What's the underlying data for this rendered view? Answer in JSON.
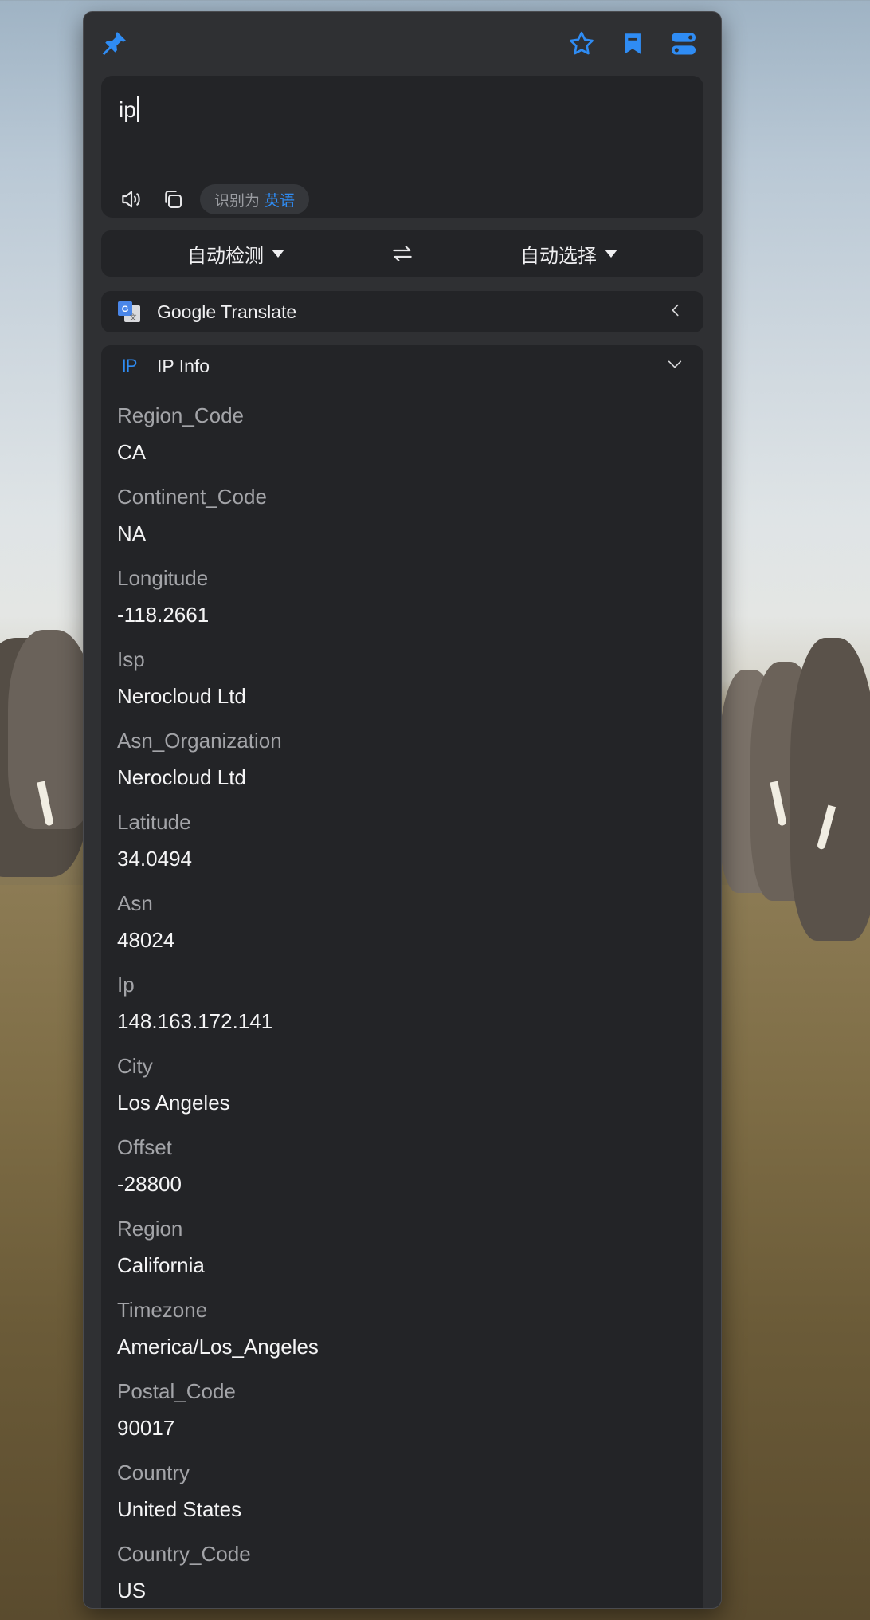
{
  "input": {
    "text": "ip"
  },
  "detect": {
    "prefix": "识别为",
    "language": "英语"
  },
  "language_bar": {
    "source": "自动检测",
    "target": "自动选择"
  },
  "services": [
    {
      "name": "Google Translate",
      "icon": "google-translate-icon",
      "expanded": false
    },
    {
      "name": "IP Info",
      "icon": "ip-icon",
      "icon_text": "IP",
      "expanded": true
    }
  ],
  "ip_info": {
    "fields": [
      {
        "key": "Region_Code",
        "value": "CA"
      },
      {
        "key": "Continent_Code",
        "value": "NA"
      },
      {
        "key": "Longitude",
        "value": "-118.2661"
      },
      {
        "key": "Isp",
        "value": "Nerocloud Ltd"
      },
      {
        "key": "Asn_Organization",
        "value": "Nerocloud Ltd"
      },
      {
        "key": "Latitude",
        "value": "34.0494"
      },
      {
        "key": "Asn",
        "value": "48024"
      },
      {
        "key": "Ip",
        "value": "148.163.172.141"
      },
      {
        "key": "City",
        "value": "Los Angeles"
      },
      {
        "key": "Offset",
        "value": "-28800"
      },
      {
        "key": "Region",
        "value": "California"
      },
      {
        "key": "Timezone",
        "value": "America/Los_Angeles"
      },
      {
        "key": "Postal_Code",
        "value": "90017"
      },
      {
        "key": "Country",
        "value": "United States"
      },
      {
        "key": "Country_Code",
        "value": "US"
      }
    ]
  },
  "colors": {
    "accent": "#2f8cf4",
    "window_bg": "#2f3033",
    "panel_bg": "#232427"
  }
}
